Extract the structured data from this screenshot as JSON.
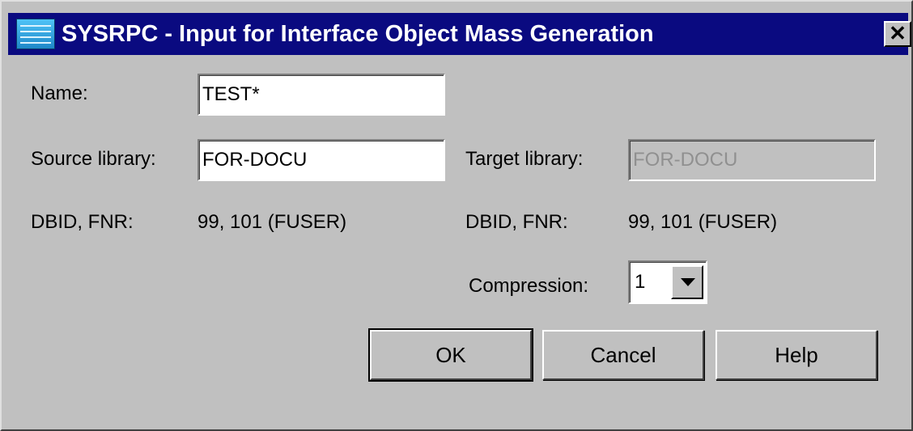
{
  "window": {
    "title": "SYSRPC - Input for Interface Object Mass Generation",
    "close_label": "✕"
  },
  "form": {
    "name_label": "Name:",
    "name_value": "TEST*",
    "source_library_label": "Source library:",
    "source_library_value": "FOR-DOCU",
    "target_library_label": "Target library:",
    "target_library_value": "FOR-DOCU",
    "source_dbid_label": "DBID, FNR:",
    "source_dbid_value": "99, 101  (FUSER)",
    "target_dbid_label": "DBID, FNR:",
    "target_dbid_value": "99, 101  (FUSER)",
    "compression_label": "Compression:",
    "compression_value": "1"
  },
  "buttons": {
    "ok": "OK",
    "cancel": "Cancel",
    "help": "Help"
  },
  "icons": {
    "title": "window-app-icon",
    "dropdown": "chevron-down-icon"
  },
  "colors": {
    "titlebar": "#0a0a80",
    "dialog": "#c0c0c0"
  }
}
